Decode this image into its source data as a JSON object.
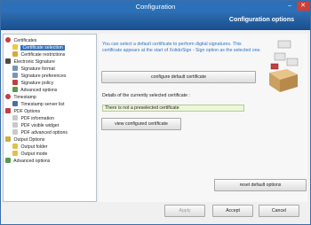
{
  "window": {
    "title": "Configuration"
  },
  "header": {
    "title": "Configuration options"
  },
  "tree": {
    "items": [
      {
        "label": "Certificates"
      },
      {
        "label": "Certificate selection"
      },
      {
        "label": "Certificate restrictions"
      },
      {
        "label": "Electronic Signature"
      },
      {
        "label": "Signature format"
      },
      {
        "label": "Signature preferences"
      },
      {
        "label": "Signature policy"
      },
      {
        "label": "Advanced options"
      },
      {
        "label": "Timestamp"
      },
      {
        "label": "Timestamp server list"
      },
      {
        "label": "PDF Options"
      },
      {
        "label": "PDF information"
      },
      {
        "label": "PDF visible widget"
      },
      {
        "label": "PDF advanced options"
      },
      {
        "label": "Output Options"
      },
      {
        "label": "Output folder"
      },
      {
        "label": "Output mode"
      },
      {
        "label": "Advanced options"
      }
    ]
  },
  "content": {
    "info": "You can select a default certificate to perform digital signatures. This certificate appears at the start of XolidoSign - Sign option as the selected one.",
    "configure_button": "configure default certificate",
    "details_label": "Details of the currently selected certificate :",
    "details_value": "There is not a preselected certificate",
    "view_button": "view configured certificate",
    "reset_button": "reset default options"
  },
  "footer": {
    "apply": "Apply",
    "accept": "Accept",
    "cancel": "Cancel"
  },
  "colors": {
    "accent": "#2b70b8",
    "selection": "#2f72c2",
    "info_text": "#2f74c8"
  }
}
